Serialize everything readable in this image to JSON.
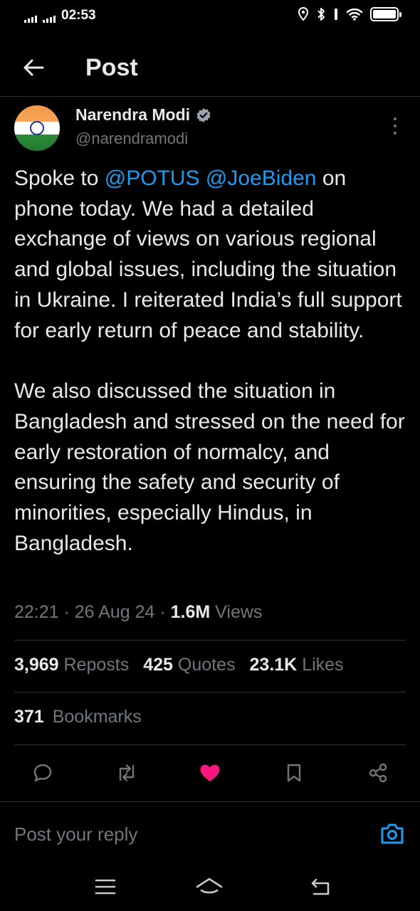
{
  "status_bar": {
    "time": "02:53"
  },
  "header": {
    "title": "Post"
  },
  "author": {
    "name": "Narendra Modi",
    "handle": "@narendramodi",
    "verified": true
  },
  "post": {
    "paragraphs": [
      {
        "segments": [
          {
            "text": "Spoke to ",
            "type": "text"
          },
          {
            "text": "@POTUS",
            "type": "mention"
          },
          {
            "text": " ",
            "type": "text"
          },
          {
            "text": "@JoeBiden",
            "type": "mention"
          },
          {
            "text": " on phone today. We had a detailed exchange of views on various regional and global issues, including the situation in Ukraine. I reiterated India’s full support for early return of peace and stability.",
            "type": "text"
          }
        ]
      },
      {
        "segments": [
          {
            "text": "We also discussed the situation in Bangladesh and stressed on the need for early restoration of normalcy, and ensuring the safety and security of minorities, especially Hindus, in Bangladesh.",
            "type": "text"
          }
        ]
      }
    ],
    "time": "22:21",
    "date": "26 Aug 24",
    "views_count": "1.6M",
    "views_label": "Views"
  },
  "stats": {
    "reposts_count": "3,969",
    "reposts_label": "Reposts",
    "quotes_count": "425",
    "quotes_label": "Quotes",
    "likes_count": "23.1K",
    "likes_label": "Likes",
    "bookmarks_count": "371",
    "bookmarks_label": "Bookmarks"
  },
  "actions": {
    "liked": true,
    "like_color": "#f91880",
    "icons": [
      "reply-icon",
      "repost-icon",
      "like-icon",
      "bookmark-icon",
      "share-icon"
    ]
  },
  "reply": {
    "placeholder": "Post your reply"
  },
  "colors": {
    "background": "#000000",
    "text": "#e7e9ea",
    "secondary": "#71767b",
    "accent": "#1d9bf0",
    "divider": "#2f3336"
  }
}
